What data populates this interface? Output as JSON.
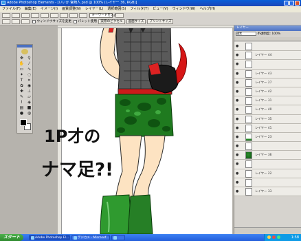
{
  "window": {
    "title": "Adobe Photoshop Elements - [いいか 宮崎人.psd @ 100% (レイヤー 36, RGB)]"
  },
  "menubar": {
    "items": [
      "ファイル(F)",
      "編集(E)",
      "イメージ(I)",
      "画質調整(N)",
      "レイヤー(L)",
      "選択範囲(S)",
      "フィルタ(T)",
      "ビュー(V)",
      "ウィンドウ(W)",
      "ヘルプ(H)"
    ]
  },
  "options": {
    "search_placeholder": "キーワードを入力",
    "checkbox_label": "ウィンドウサイズを変更",
    "checkbox2_label": "パレット使用",
    "btn_actual": "実際のピクセル",
    "btn_fit": "画面サイズ",
    "btn_print": "プリントサイズ",
    "palette_well": "ヒント  ブラシ  スタイル  スウォッチ  レイヤースタイル  レイヤー  ヒストリー"
  },
  "layers": {
    "title": "レイヤー",
    "mode": "通常",
    "opacity_label": "不透明度: 100%",
    "items": [
      {
        "name": "",
        "thumb": "plain"
      },
      {
        "name": "レイヤー 44",
        "thumb": "plain"
      },
      {
        "name": "",
        "thumb": "plain"
      },
      {
        "name": "レイヤー 43",
        "thumb": "plain"
      },
      {
        "name": "レイヤー 27",
        "thumb": "plain"
      },
      {
        "name": "レイヤー 42",
        "thumb": "plain"
      },
      {
        "name": "レイヤー 31",
        "thumb": "plain"
      },
      {
        "name": "レイヤー 40",
        "thumb": "plain"
      },
      {
        "name": "レイヤー 35",
        "thumb": "plain"
      },
      {
        "name": "レイヤー 41",
        "thumb": "plain"
      },
      {
        "name": "レイヤー 23",
        "thumb": "green-small"
      },
      {
        "name": "",
        "thumb": "plain"
      },
      {
        "name": "レイヤー 36",
        "thumb": "green"
      },
      {
        "name": "",
        "thumb": "plain"
      },
      {
        "name": "レイヤー 22",
        "thumb": "plain"
      },
      {
        "name": "",
        "thumb": "plain"
      },
      {
        "name": "レイヤー 33",
        "thumb": "plain"
      }
    ]
  },
  "canvas": {
    "handwritten_line1": "1P才の",
    "handwritten_line2": "ナマ足?!"
  },
  "taskbar": {
    "start_label": "スタート",
    "tasks": [
      "Adobe Photoshop El...",
      "デジカメ - Microsof...",
      ""
    ],
    "clock": "1:58"
  }
}
